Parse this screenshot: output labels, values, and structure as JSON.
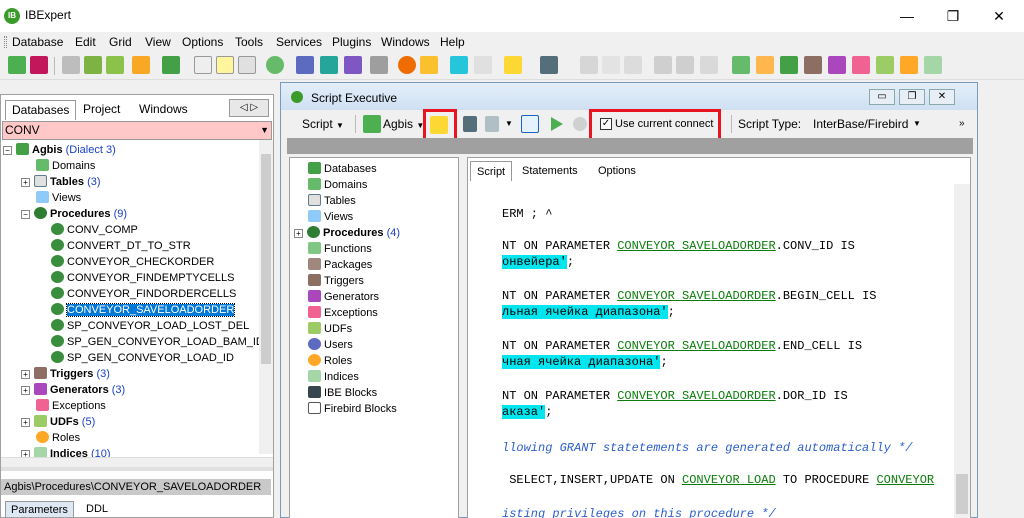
{
  "window": {
    "title": "IBExpert"
  },
  "menu": [
    "Database",
    "Edit",
    "Grid",
    "View",
    "Options",
    "Tools",
    "Services",
    "Plugins",
    "Windows",
    "Help"
  ],
  "left_tabs": [
    "Databases",
    "Project",
    "Windows"
  ],
  "db_combo": "CONV",
  "tree": {
    "root": {
      "label": "Agbis",
      "note": "(Dialect 3)"
    },
    "domains": "Domains",
    "tables": {
      "label": "Tables",
      "count": "(3)"
    },
    "views": "Views",
    "procedures": {
      "label": "Procedures",
      "count": "(9)"
    },
    "proc_items": [
      "CONV_COMP",
      "CONVERT_DT_TO_STR",
      "CONVEYOR_CHECKORDER",
      "CONVEYOR_FINDEMPTYCELLS",
      "CONVEYOR_FINDORDERCELLS",
      "CONVEYOR_SAVELOADORDER",
      "SP_CONVEYOR_LOAD_LOST_DEL",
      "SP_GEN_CONVEYOR_LOAD_BAM_ID",
      "SP_GEN_CONVEYOR_LOAD_ID"
    ],
    "triggers": {
      "label": "Triggers",
      "count": "(3)"
    },
    "generators": {
      "label": "Generators",
      "count": "(3)"
    },
    "exceptions": "Exceptions",
    "udfs": {
      "label": "UDFs",
      "count": "(5)"
    },
    "roles": "Roles",
    "indices": {
      "label": "Indices",
      "count": "(10)"
    }
  },
  "path": "Agbis\\Procedures\\CONVEYOR_SAVELOADORDER",
  "bottom_tabs": [
    "Parameters",
    "DDL"
  ],
  "script_exec": {
    "title": "Script Executive",
    "script_btn": "Script",
    "agbis_btn": "Agbis",
    "use_current": "Use current connect",
    "script_type_label": "Script Type:",
    "script_type_value": "InterBase/Firebird",
    "obj_tree": [
      "Databases",
      "Domains",
      "Tables",
      "Views",
      "Procedures",
      "Functions",
      "Packages",
      "Triggers",
      "Generators",
      "Exceptions",
      "UDFs",
      "Users",
      "Roles",
      "Indices",
      "IBE Blocks",
      "Firebird Blocks"
    ],
    "proc_count": "(4)",
    "editor_tabs": [
      "Script",
      "Statements",
      "Options"
    ]
  },
  "code": {
    "l1": "ERM ; ^",
    "l2a": "NT ON PARAMETER ",
    "l2b": "CONVEYOR SAVELOADORDER",
    "l2c": ".CONV_ID IS",
    "l3": "онвейера'",
    "l3b": ";",
    "l4a": "NT ON PARAMETER ",
    "l4b": "CONVEYOR SAVELOADORDER",
    "l4c": ".BEGIN_CELL IS",
    "l5": "льная ячейка диапазона'",
    "l5b": ";",
    "l6a": "NT ON PARAMETER ",
    "l6b": "CONVEYOR SAVELOADORDER",
    "l6c": ".END_CELL IS",
    "l7": "чная ячейка диапазона'",
    "l7b": ";",
    "l8a": "NT ON PARAMETER ",
    "l8b": "CONVEYOR SAVELOADORDER",
    "l8c": ".DOR_ID IS",
    "l9": "аказа'",
    "l9b": ";",
    "l10": "llowing GRANT statetements are generated automatically */",
    "l11a": " SELECT,INSERT,UPDATE ON ",
    "l11b": "CONVEYOR LOAD",
    "l11c": " TO PROCEDURE ",
    "l11d": "CONVEYOR",
    "l12": "isting privileges on this procedure */"
  },
  "colors": {
    "highlight_red": "#e8141f",
    "cyan": "#00e5ee",
    "selection": "#0078d7"
  }
}
